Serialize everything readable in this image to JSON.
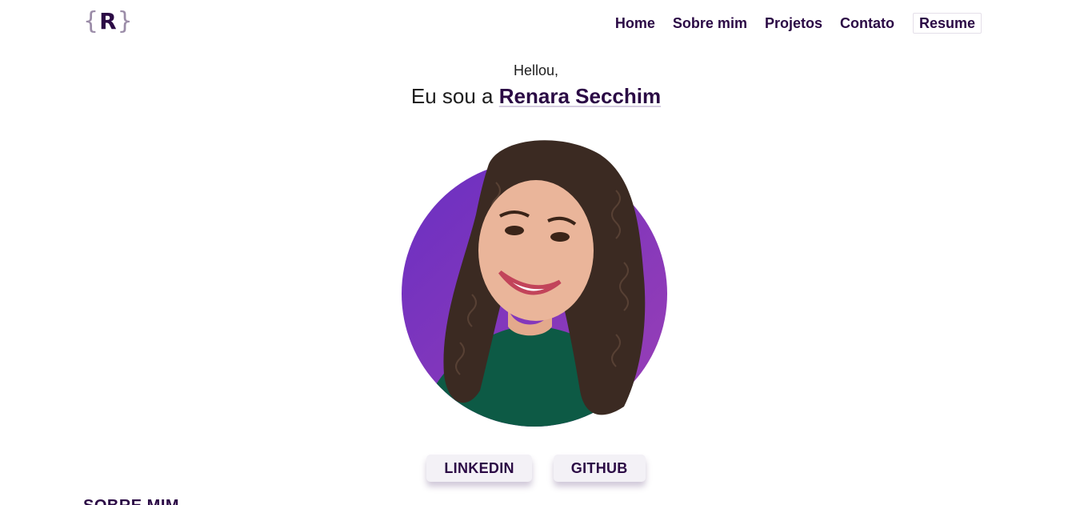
{
  "header": {
    "logo": {
      "open_brace": "{",
      "letter": "R",
      "close_brace": "}"
    },
    "nav": [
      {
        "label": "Home"
      },
      {
        "label": "Sobre mim"
      },
      {
        "label": "Projetos"
      },
      {
        "label": "Contato"
      },
      {
        "label": "Resume"
      }
    ]
  },
  "hero": {
    "greeting": "Hellou,",
    "intro": "Eu sou a",
    "name": "Renara Secchim"
  },
  "photo": {
    "gradient_start": "#6a2fc2",
    "gradient_end": "#9a3fb5"
  },
  "social": {
    "linkedin_label": "LINKEDIN",
    "github_label": "GITHUB"
  },
  "about": {
    "heading": "SOBRE MIM"
  },
  "colors": {
    "brand": "#2b0a45",
    "button_bg": "#f3f1f6"
  }
}
